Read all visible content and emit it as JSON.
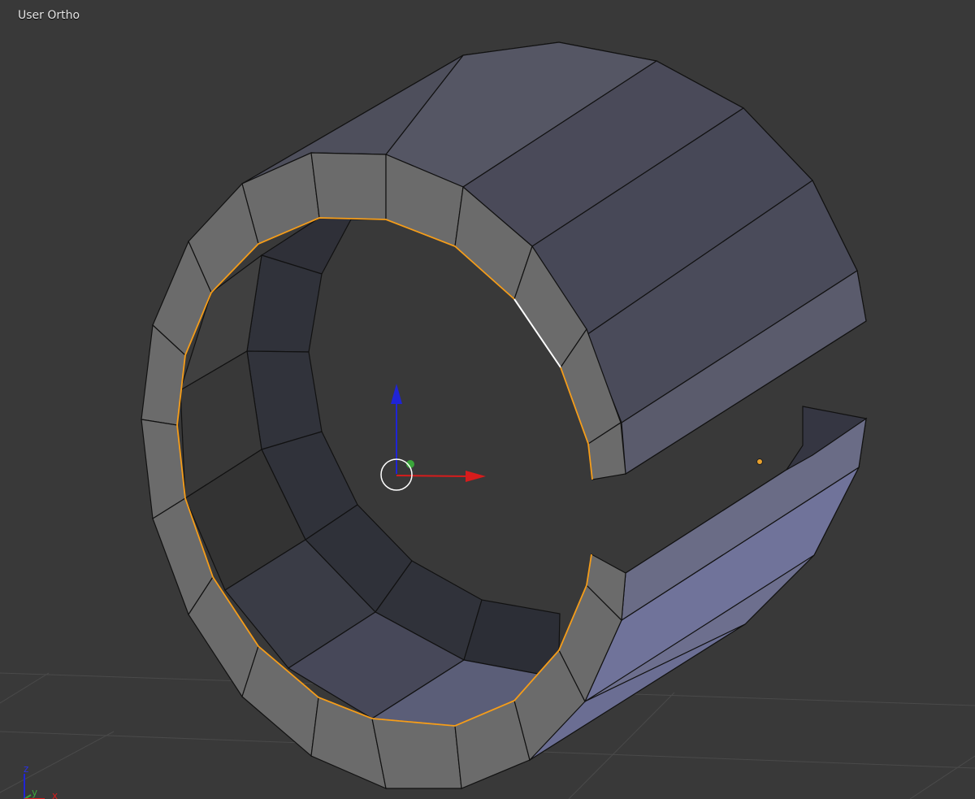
{
  "viewport": {
    "view_label": "User Ortho"
  },
  "axis_widget": {
    "z_label": "z",
    "y_label": "y",
    "x_label": "x"
  },
  "colors": {
    "background": "#393939",
    "grid": "#474747",
    "outer_face": "#6b6b6b",
    "inner_face": "#30323a",
    "top_face": "#4a4b58",
    "bottom_face": "#6e7192",
    "selection_edge": "#f59d1a",
    "axis_x": "#d61c1c",
    "axis_y": "#3aa63a",
    "axis_z": "#1f24d6",
    "origin_dot": "#e8a02c"
  },
  "icons": {
    "3d_cursor": "cursor-icon",
    "manipulator": "transform-manipulator-icon",
    "axis_widget": "axis-gizmo-icon"
  }
}
